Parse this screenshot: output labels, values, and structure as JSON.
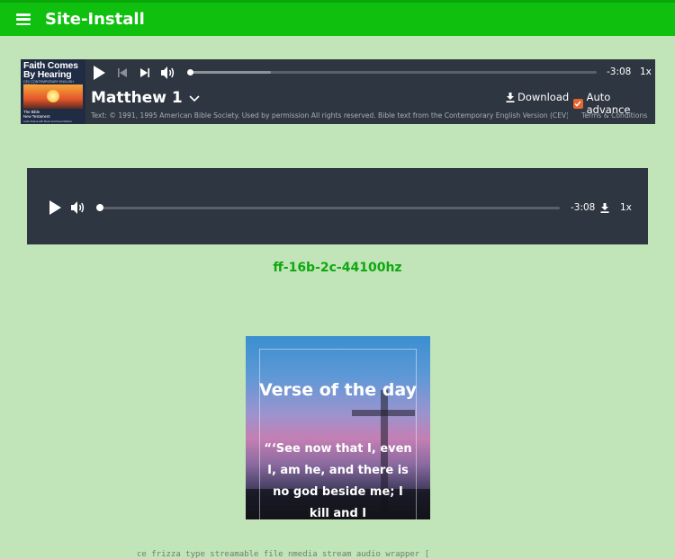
{
  "header": {
    "title": "Site-Install",
    "bg_color": "#0fc00f"
  },
  "bible_player": {
    "cover": {
      "title": "Faith Comes By Hearing",
      "subtitle": "CEV CONTEMPORARY ENGLISH VERSION",
      "book_line1": "The Bible",
      "book_line2": "New Testament",
      "note": "Audio Drama with Music and Sound Effects"
    },
    "time_remaining": "-3:08",
    "speed": "1x",
    "progress_fraction": 0.02,
    "buffered_fraction": 0.2,
    "chapter": "Matthew 1",
    "download_label": "Download",
    "auto_advance_label": "Auto advance",
    "auto_advance_checked": true,
    "copyright": "Text: © 1991, 1995 American Bible Society. Used by permission All rights reserved. Bible text from the Contemporary English Version (CEV)",
    "terms_label": "Terms & Conditions"
  },
  "audio_player": {
    "time_remaining": "-3:08",
    "speed": "1x",
    "progress_fraction": 0.0
  },
  "file_label": "ff-16b-2c-44100hz",
  "verse_card": {
    "title": "Verse of the day",
    "text": "“‘See now that I, even I, am he, and there is no god beside me; I kill and I"
  },
  "code_snippet": "ce   frizza  type streamable file nmedia stream audio wrapper ["
}
